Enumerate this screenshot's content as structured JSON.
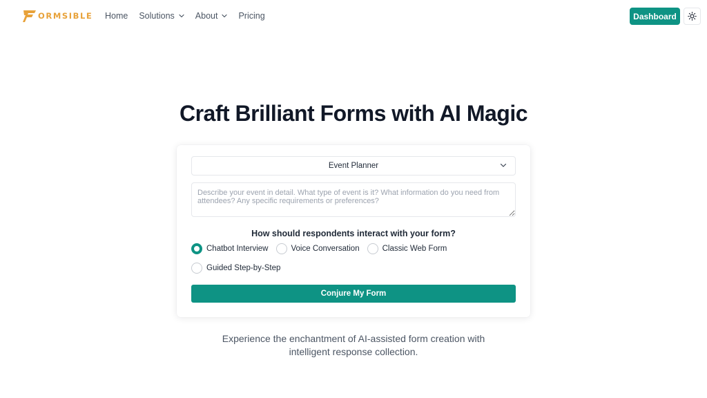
{
  "brand": {
    "name": "ORMSIBLE",
    "logo_icon": "f-logo-icon",
    "color": "#e8a23a"
  },
  "nav": {
    "items": [
      {
        "label": "Home",
        "has_dropdown": false
      },
      {
        "label": "Solutions",
        "has_dropdown": true
      },
      {
        "label": "About",
        "has_dropdown": true
      },
      {
        "label": "Pricing",
        "has_dropdown": false
      }
    ]
  },
  "header": {
    "dashboard_label": "Dashboard",
    "theme_icon": "sun-icon"
  },
  "hero": {
    "title": "Craft Brilliant Forms with AI Magic"
  },
  "form": {
    "template_select": {
      "value": "Event Planner"
    },
    "description": {
      "value": "",
      "placeholder": "Describe your event in detail. What type of event is it? What information do you need from attendees? Any specific requirements or preferences?"
    },
    "interaction_question": "How should respondents interact with your form?",
    "interaction_options": [
      {
        "label": "Chatbot Interview",
        "selected": true
      },
      {
        "label": "Voice Conversation",
        "selected": false
      },
      {
        "label": "Classic Web Form",
        "selected": false
      },
      {
        "label": "Guided Step-by-Step",
        "selected": false
      }
    ],
    "submit_label": "Conjure My Form"
  },
  "tagline": "Experience the enchantment of AI-assisted form creation with intelligent response collection.",
  "colors": {
    "accent": "#0e9384",
    "brand": "#e8a23a",
    "heading": "#111827",
    "muted_text": "#4b5563"
  }
}
